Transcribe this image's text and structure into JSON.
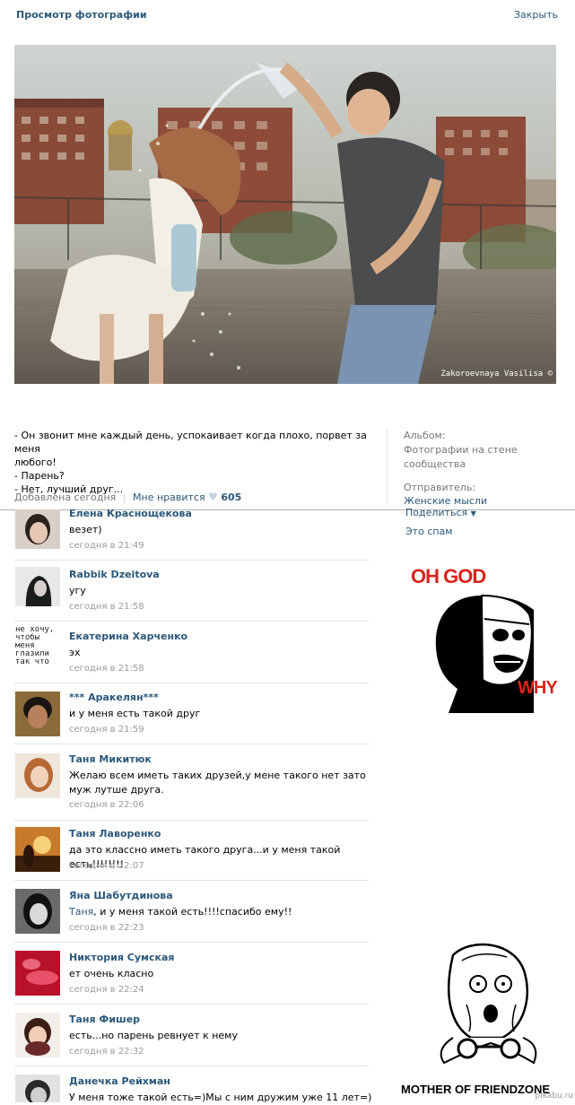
{
  "header": {
    "title": "Просмотр фотографии",
    "close_label": "Закрыть"
  },
  "photo": {
    "watermark": "Zakoroevnaya Vasilisa ©"
  },
  "post": {
    "text_lines": [
      "- Он звонит мне каждый день, успокаивает когда плохо, порвет за меня",
      "любого!",
      "- Парень?",
      "- Нет, лучший друг..."
    ],
    "added": "Добавлена сегодня",
    "like_label": "Мне нравится",
    "like_count": "605"
  },
  "sidebar": {
    "album_label": "Альбом:",
    "album_line1": "Фотографии на стене",
    "album_line2": "сообщества",
    "sender_label": "Отправитель:",
    "sender_name": "Женские мысли",
    "share_label": "Поделиться",
    "spam_label": "Это спам"
  },
  "memes": {
    "top_line1": "OH GOD",
    "top_line2": "WHY",
    "bottom_caption": "MOTHER OF FRIENDZONE"
  },
  "avatar_art": {
    "ekaterina": [
      "не хочу,",
      "чтобы",
      "меня",
      "глазили",
      "так что"
    ]
  },
  "comments": [
    {
      "name": "Елена Краснощекова",
      "text": "везет)",
      "time": "сегодня в 21:49"
    },
    {
      "name": "Rabbik Dzeitova",
      "text": "угу",
      "time": "сегодня в 21:58"
    },
    {
      "name": "Екатерина Харченко",
      "text": "эх",
      "time": "сегодня в 21:58"
    },
    {
      "name": "*** Аракелян***",
      "text": "и у меня есть такой друг",
      "time": "сегодня в 21:59"
    },
    {
      "name": "Таня Микитюк",
      "text": "Желаю всем иметь таких друзей,у мене такого нет зато муж лутше друга.",
      "time": "сегодня в 22:06"
    },
    {
      "name": "Таня Лаворенко",
      "text": "да это классно иметь такого друга...и у меня такой есть!!!!!!!!",
      "time": "сегодня в 22:07"
    },
    {
      "name": "Яна Шабутдинова",
      "reply_to": "Таня",
      "text": ", и у меня такой есть!!!!спасибо ему!!",
      "time": "сегодня в 22:23"
    },
    {
      "name": "Никтория Сумская",
      "text": "ет очень класно",
      "time": "сегодня в 22:24"
    },
    {
      "name": "Таня Фишер",
      "text": "есть...но парень ревнует к нему",
      "time": "сегодня в 22:32"
    },
    {
      "name": "Данечка Рейхман",
      "text": "У меня тоже такой есть=)Мы с ним дружим уже 11 лет=)",
      "time": ""
    }
  ],
  "footer": {
    "site": "pikabu.ru"
  },
  "colors": {
    "link": "#2b587a",
    "meme_red": "#d9241c"
  }
}
